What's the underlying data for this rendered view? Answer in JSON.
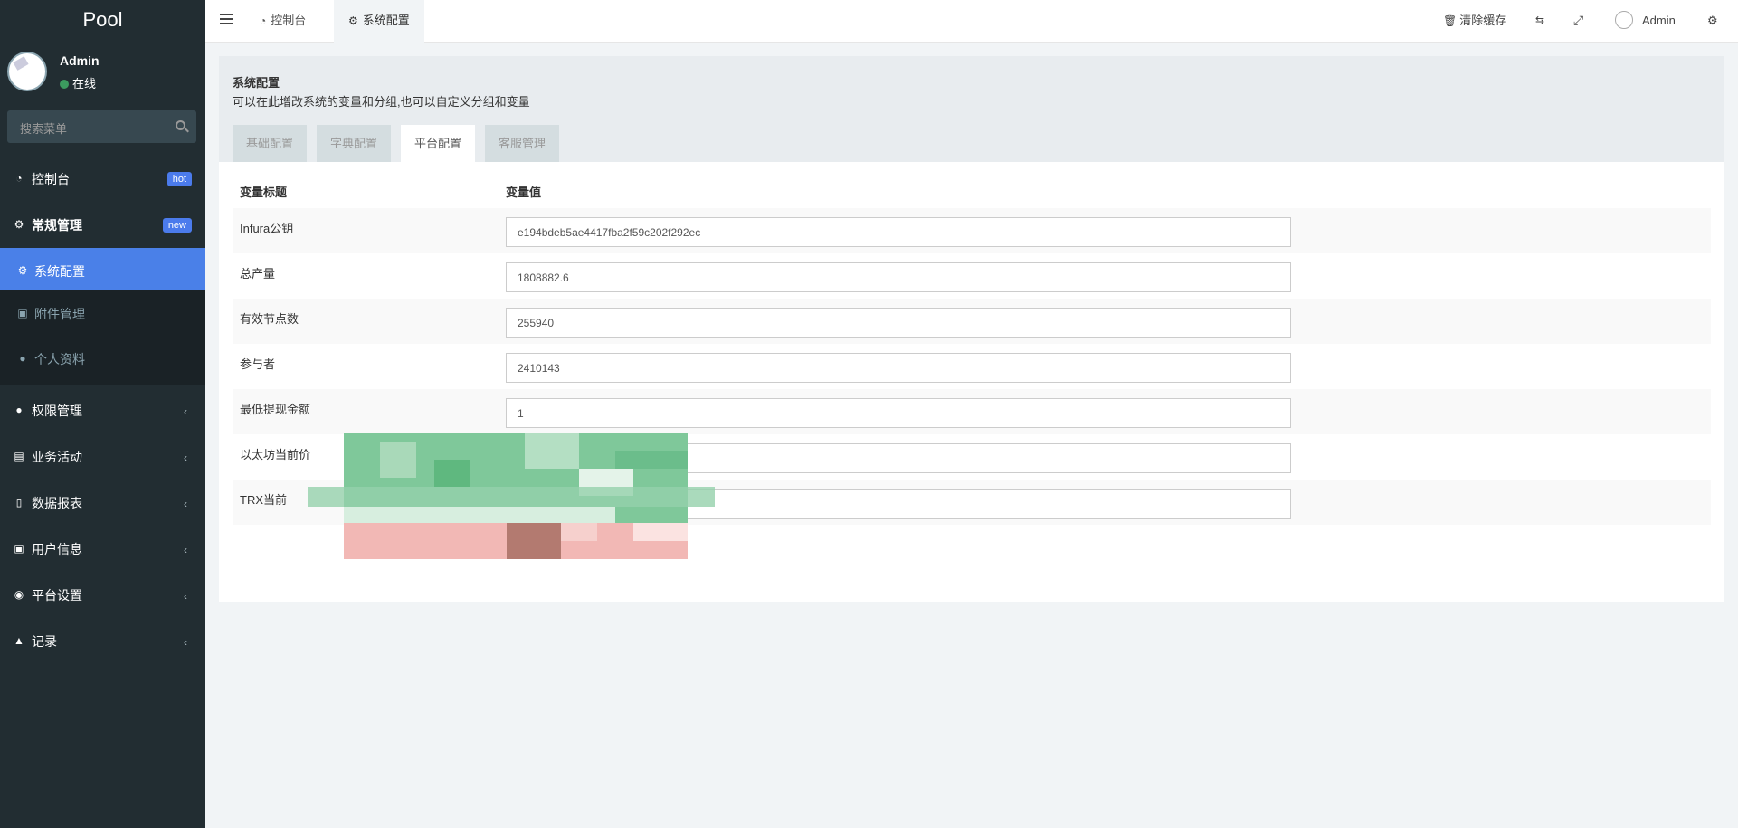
{
  "app": {
    "logo": "Pool"
  },
  "user": {
    "name": "Admin",
    "status": "在线"
  },
  "sidebar": {
    "search_placeholder": "搜索菜单",
    "items": [
      {
        "label": "控制台",
        "icon": "dashboard-icon",
        "badge": "hot"
      },
      {
        "label": "常规管理",
        "icon": "cogs-icon",
        "badge": "new"
      },
      {
        "label": "系统配置",
        "icon": "gear-icon",
        "active": true
      },
      {
        "label": "附件管理",
        "icon": "file-image-icon"
      },
      {
        "label": "个人资料",
        "icon": "user-icon"
      },
      {
        "label": "权限管理",
        "icon": "group-icon"
      },
      {
        "label": "业务活动",
        "icon": "list-alt-icon"
      },
      {
        "label": "数据报表",
        "icon": "file-text-icon"
      },
      {
        "label": "用户信息",
        "icon": "address-book-icon"
      },
      {
        "label": "平台设置",
        "icon": "circle-icon"
      },
      {
        "label": "记录",
        "icon": "area-chart-icon"
      }
    ],
    "badge_color": "#4b7bec",
    "active_color": "#4a80e8"
  },
  "topbar": {
    "tabs": [
      {
        "label": "控制台",
        "icon": "dashboard-icon"
      },
      {
        "label": "系统配置",
        "icon": "gear-icon",
        "active": true
      }
    ],
    "clear_cache": "清除缓存",
    "user_name": "Admin"
  },
  "panel": {
    "title": "系统配置",
    "description": "可以在此增改系统的变量和分组,也可以自定义分组和变量",
    "tabs": [
      "基础配置",
      "字典配置",
      "平台配置",
      "客服管理"
    ],
    "active_tab": "平台配置",
    "table": {
      "col_title": "变量标题",
      "col_value": "变量值",
      "rows": [
        {
          "label": "Infura公钥",
          "value": "e194bdeb5ae4417fba2f59c202f292ec"
        },
        {
          "label": "总产量",
          "value": "1808882.6"
        },
        {
          "label": "有效节点数",
          "value": "255940"
        },
        {
          "label": "参与者",
          "value": "2410143"
        },
        {
          "label": "最低提现金额",
          "value": "1"
        },
        {
          "label": "以太坊当前价",
          "value": ""
        },
        {
          "label": "TRX当前",
          "value": ""
        }
      ]
    }
  }
}
